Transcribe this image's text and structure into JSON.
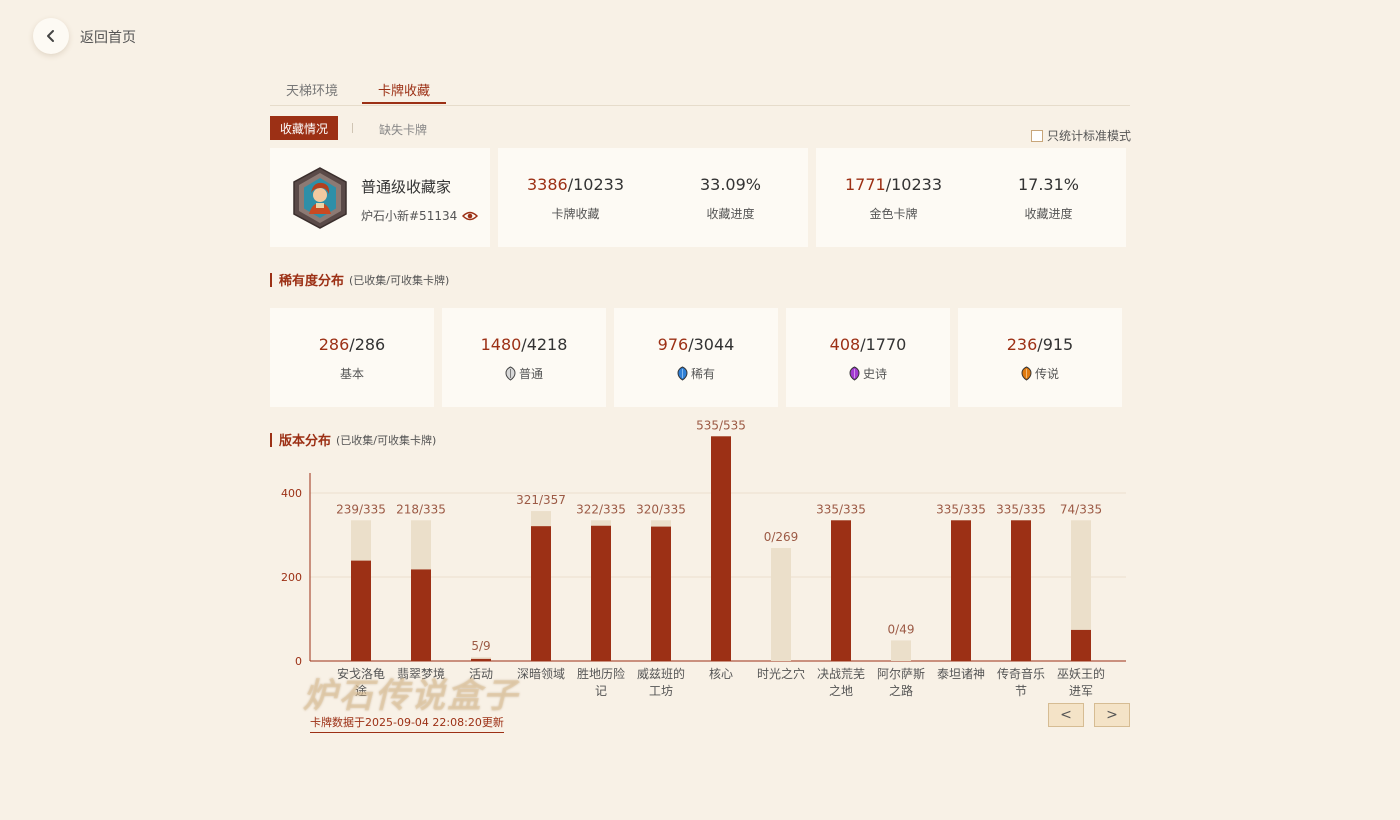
{
  "nav": {
    "back_label": "返回首页"
  },
  "tabs": [
    {
      "label": "天梯环境"
    },
    {
      "label": "卡牌收藏"
    }
  ],
  "subtabs": {
    "active": "收藏情况",
    "other": "缺失卡牌"
  },
  "standard_only": {
    "label": "只统计标准模式",
    "checked": false
  },
  "profile": {
    "title": "普通级收藏家",
    "name": "炉石小新#51134"
  },
  "summary": [
    {
      "value_hl": "3386",
      "value_rest": "/10233",
      "label": "卡牌收藏"
    },
    {
      "value_hl": "",
      "value_rest": "33.09%",
      "label": "收藏进度"
    },
    {
      "value_hl": "1771",
      "value_rest": "/10233",
      "label": "金色卡牌"
    },
    {
      "value_hl": "",
      "value_rest": "17.31%",
      "label": "收藏进度"
    }
  ],
  "rarity_section": {
    "title": "稀有度分布",
    "subtitle": "(已收集/可收集卡牌)"
  },
  "rarity": [
    {
      "collected": "286",
      "total": "/286",
      "label": "基本",
      "gem": "none"
    },
    {
      "collected": "1480",
      "total": "/4218",
      "label": "普通",
      "gem": "#d8d8d8"
    },
    {
      "collected": "976",
      "total": "/3044",
      "label": "稀有",
      "gem": "#2f7fd6"
    },
    {
      "collected": "408",
      "total": "/1770",
      "label": "史诗",
      "gem": "#a23ad0"
    },
    {
      "collected": "236",
      "total": "/915",
      "label": "传说",
      "gem": "#e07a10"
    }
  ],
  "version_section": {
    "title": "版本分布",
    "subtitle": "(已收集/可收集卡牌)"
  },
  "chart_data": {
    "type": "bar",
    "stacked_overlay": true,
    "categories": [
      "安戈洛龟途",
      "翡翠梦境",
      "活动",
      "深暗领域",
      "胜地历险记",
      "威兹班的工坊",
      "核心",
      "时光之穴",
      "决战荒芜之地",
      "阿尔萨斯之路",
      "泰坦诸神",
      "传奇音乐节",
      "巫妖王的进军"
    ],
    "category_lines": [
      [
        "安戈洛龟",
        "途"
      ],
      [
        "翡翠梦境"
      ],
      [
        "活动"
      ],
      [
        "深暗领域"
      ],
      [
        "胜地历险",
        "记"
      ],
      [
        "威兹班的",
        "工坊"
      ],
      [
        "核心"
      ],
      [
        "时光之穴"
      ],
      [
        "决战荒芜",
        "之地"
      ],
      [
        "阿尔萨斯",
        "之路"
      ],
      [
        "泰坦诸神"
      ],
      [
        "传奇音乐",
        "节"
      ],
      [
        "巫妖王的",
        "进军"
      ]
    ],
    "series": [
      {
        "name": "已收集",
        "values": [
          239,
          218,
          5,
          321,
          322,
          320,
          535,
          0,
          335,
          0,
          335,
          335,
          74
        ]
      },
      {
        "name": "可收集",
        "values": [
          335,
          335,
          9,
          357,
          335,
          335,
          535,
          269,
          335,
          49,
          335,
          335,
          335
        ]
      }
    ],
    "labels": [
      "239/335",
      "218/335",
      "5/9",
      "321/357",
      "322/335",
      "320/335",
      "535/535",
      "0/269",
      "335/335",
      "0/49",
      "335/335",
      "335/335",
      "74/335"
    ],
    "yticks": [
      0,
      200,
      400
    ],
    "ylim": [
      0,
      450
    ],
    "grid": true,
    "colors": {
      "collected": "#9c3015",
      "total": "#ebdfca"
    }
  },
  "update_note": "卡牌数据于2025-09-04 22:08:20更新",
  "pager": {
    "prev": "<",
    "next": ">"
  },
  "watermark": "炉石传说盒子"
}
